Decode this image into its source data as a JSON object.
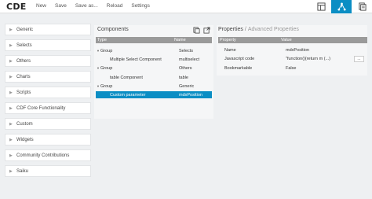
{
  "app": {
    "logo": "CDE"
  },
  "menu": {
    "new": "New",
    "save": "Save",
    "save_as": "Save as...",
    "reload": "Reload",
    "settings": "Settings"
  },
  "view_buttons": [
    {
      "icon": "layout-icon",
      "active": false
    },
    {
      "icon": "components-icon",
      "active": true
    },
    {
      "icon": "datasources-icon",
      "active": false
    }
  ],
  "sidebar": {
    "items": [
      {
        "label": "Generic"
      },
      {
        "label": "Selects"
      },
      {
        "label": "Others"
      },
      {
        "label": "Charts"
      },
      {
        "label": "Scripts"
      },
      {
        "label": "CDF Core Functionality"
      },
      {
        "label": "Custom"
      },
      {
        "label": "Widgets"
      },
      {
        "label": "Community Contributions"
      },
      {
        "label": "Saiku"
      }
    ]
  },
  "components": {
    "title": "Components",
    "columns": {
      "type": "Type",
      "name": "Name"
    },
    "rows": [
      {
        "type": "Group",
        "name": "Selects",
        "group": true
      },
      {
        "type": "Multiple Select Component",
        "name": "multiselect",
        "group": false
      },
      {
        "type": "Group",
        "name": "Others",
        "group": true
      },
      {
        "type": "table Component",
        "name": "table",
        "group": false
      },
      {
        "type": "Group",
        "name": "Generic",
        "group": true
      },
      {
        "type": "Custom parameter",
        "name": "mdxPosition",
        "group": false,
        "selected": true
      }
    ]
  },
  "properties": {
    "title": "Properties",
    "separator": "/",
    "advanced": "Advanced Properties",
    "columns": {
      "property": "Property",
      "value": "Value"
    },
    "rows": [
      {
        "property": "Name",
        "value": "mdxPosition"
      },
      {
        "property": "Javascript code",
        "value": "\"function(){return m (...)",
        "button": "..."
      },
      {
        "property": "Bookmarkable",
        "value": "False"
      }
    ]
  },
  "colors": {
    "accent": "#0b8ec4",
    "header": "#9a9a9a"
  }
}
